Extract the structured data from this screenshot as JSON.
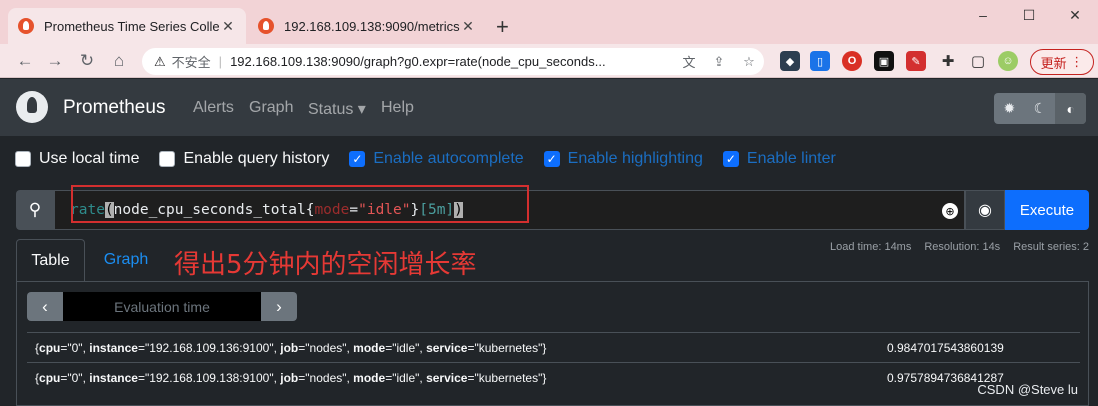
{
  "browser": {
    "tabs": [
      {
        "title": "Prometheus Time Series Collec",
        "active": true
      },
      {
        "title": "192.168.109.138:9090/metrics",
        "active": false
      }
    ],
    "new_tab": "+",
    "window_controls": [
      "–",
      "☐",
      "✕"
    ],
    "security_label": "不安全",
    "url": "192.168.109.138:9090/graph?g0.expr=rate(node_cpu_seconds...",
    "update_button": "更新"
  },
  "app": {
    "brand": "Prometheus",
    "nav": [
      "Alerts",
      "Graph",
      "Status ▾",
      "Help"
    ],
    "theme_icons": [
      "sun-icon",
      "moon-icon",
      "contrast-icon"
    ]
  },
  "options": [
    {
      "label": "Use local time",
      "checked": false
    },
    {
      "label": "Enable query history",
      "checked": false
    },
    {
      "label": "Enable autocomplete",
      "checked": true
    },
    {
      "label": "Enable highlighting",
      "checked": true
    },
    {
      "label": "Enable linter",
      "checked": true
    }
  ],
  "query": {
    "fn": "rate",
    "open": "(",
    "metric": "node_cpu_seconds_total",
    "lbrace": "{",
    "label": "mode",
    "eq": "=",
    "value": "\"idle\"",
    "rbrace": "}",
    "range": "[5m]",
    "close": ")",
    "execute_label": "Execute"
  },
  "panel": {
    "tabs": [
      "Table",
      "Graph"
    ],
    "annotation": "得出5分钟内的空闲增长率",
    "stats": {
      "load_time": "Load time: 14ms",
      "resolution": "Resolution: 14s",
      "result_series": "Result series: 2"
    },
    "eval_placeholder": "Evaluation time",
    "results": [
      {
        "cpu": "\"0\"",
        "instance": "\"192.168.109.136:9100\"",
        "job": "\"nodes\"",
        "mode": "\"idle\"",
        "service": "\"kubernetes\"",
        "value": "0.9847017543860139"
      },
      {
        "cpu": "\"0\"",
        "instance": "\"192.168.109.138:9100\"",
        "job": "\"nodes\"",
        "mode": "\"idle\"",
        "service": "\"kubernetes\"",
        "value": "0.9757894736841287"
      }
    ]
  },
  "watermark": "CSDN @Steve lu"
}
